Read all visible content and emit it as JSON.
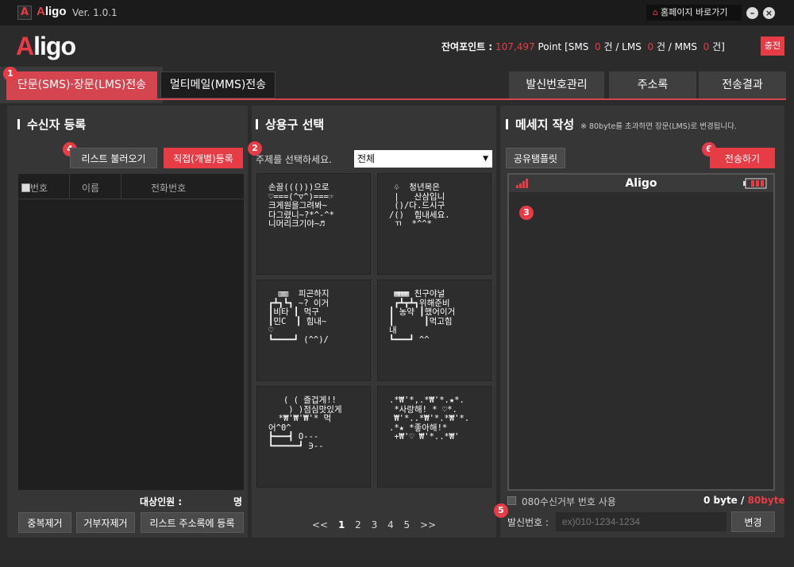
{
  "titlebar": {
    "logo_letter": "A",
    "app_name_a": "A",
    "app_name_rest": "ligo",
    "version": "Ver. 1.0.1",
    "home_icon": "home-icon",
    "home_label": "홈페이지 바로가기",
    "minimize": "–",
    "close": "×"
  },
  "header": {
    "logo_a": "A",
    "logo_rest": "ligo",
    "points_label": "잔여포인트 :",
    "points_value": "107,497",
    "points_unit": "Point [SMS",
    "sms_count": "0",
    "lms_label": "건 / LMS",
    "lms_count": "0",
    "mms_label": "건 / MMS",
    "mms_count": "0",
    "end_label": "건]",
    "charge_label": "충전"
  },
  "tabs": {
    "sms": "단문(SMS)·장문(LMS)전송",
    "mms": "멀티메일(MMS)전송",
    "sender_mgmt": "발신번호관리",
    "addressbook": "주소록",
    "results": "전송결과"
  },
  "badges": [
    "1",
    "2",
    "3",
    "4",
    "5",
    "6"
  ],
  "recipients": {
    "title": "수신자 등록",
    "load_list": "리스트 불러오기",
    "direct_register": "직접(개별)등록",
    "columns": [
      "번호",
      "이름",
      "전화번호"
    ],
    "target_label": "대상인원 :",
    "target_unit": "명",
    "dedupe": "중복제거",
    "remove_rejected": "거부자제거",
    "save_to_address": "리스트 주소록에 등록"
  },
  "phrases": {
    "title": "상용구 선택",
    "topic_label": "주제를 선택하세요.",
    "topic_value": "전체",
    "cards": [
      "손끌((()))으로\n♡===(^▽^)===☞\n크게원을그려봐~\n다그렸니~?*^-^*\n니머리크기야~♬",
      " ♧  청년목은\n |   산삼입니\n ()/다.드시구\n/()  힘내세요.\n ㄲ  *^^*",
      "  ▥▥  피곤하지\n┏┻┓┗┓ ~? 이거\n┃비타 ┃ 먹구\n┃민C  ┃ 힘내~\n♡\n┗━━━━┛ (^^)/",
      " ▦▦▦ 친구야널\n ┏┻┳┻┓위해준비\n┃ 농약 ┃했어이거\n┃      ┃먹고힘\n내\n┗━━━┛ ^^",
      "   ( ( 즐겁게!!\n    ) )점심맛있게\n  *₩'₩'₩'* 먹\n어^0^\n┣━━━┫ O---\n┗━━━━━┛ ∋--",
      ".*₩'*,.*₩'*.★*.\n *사랑해! * ♡*.\n ₩'*..*₩'*.*₩'*.\n.*★ *좋아해!*\n +₩'♡ ₩'*..*₩'"
    ],
    "pager": {
      "first": "<<",
      "pages": [
        "1",
        "2",
        "3",
        "4",
        "5"
      ],
      "next": ">>"
    }
  },
  "message": {
    "title": "메세지 작성",
    "note": "※ 80byte를 초과하면 장문(LMS)로 변경됩니다.",
    "share_template": "공유탬플릿",
    "send": "전송하기",
    "phone_title": "Aligo",
    "signal_icon": "signal-icon",
    "battery_icon": "battery-icon",
    "reject_label": "080수신거부 번호 사용",
    "bytes_value": "0 byte",
    "bytes_sep": " / ",
    "bytes_limit": "80byte",
    "sender_label": "발신번호 :",
    "sender_placeholder": "ex)010-1234-1234",
    "change": "변경"
  }
}
